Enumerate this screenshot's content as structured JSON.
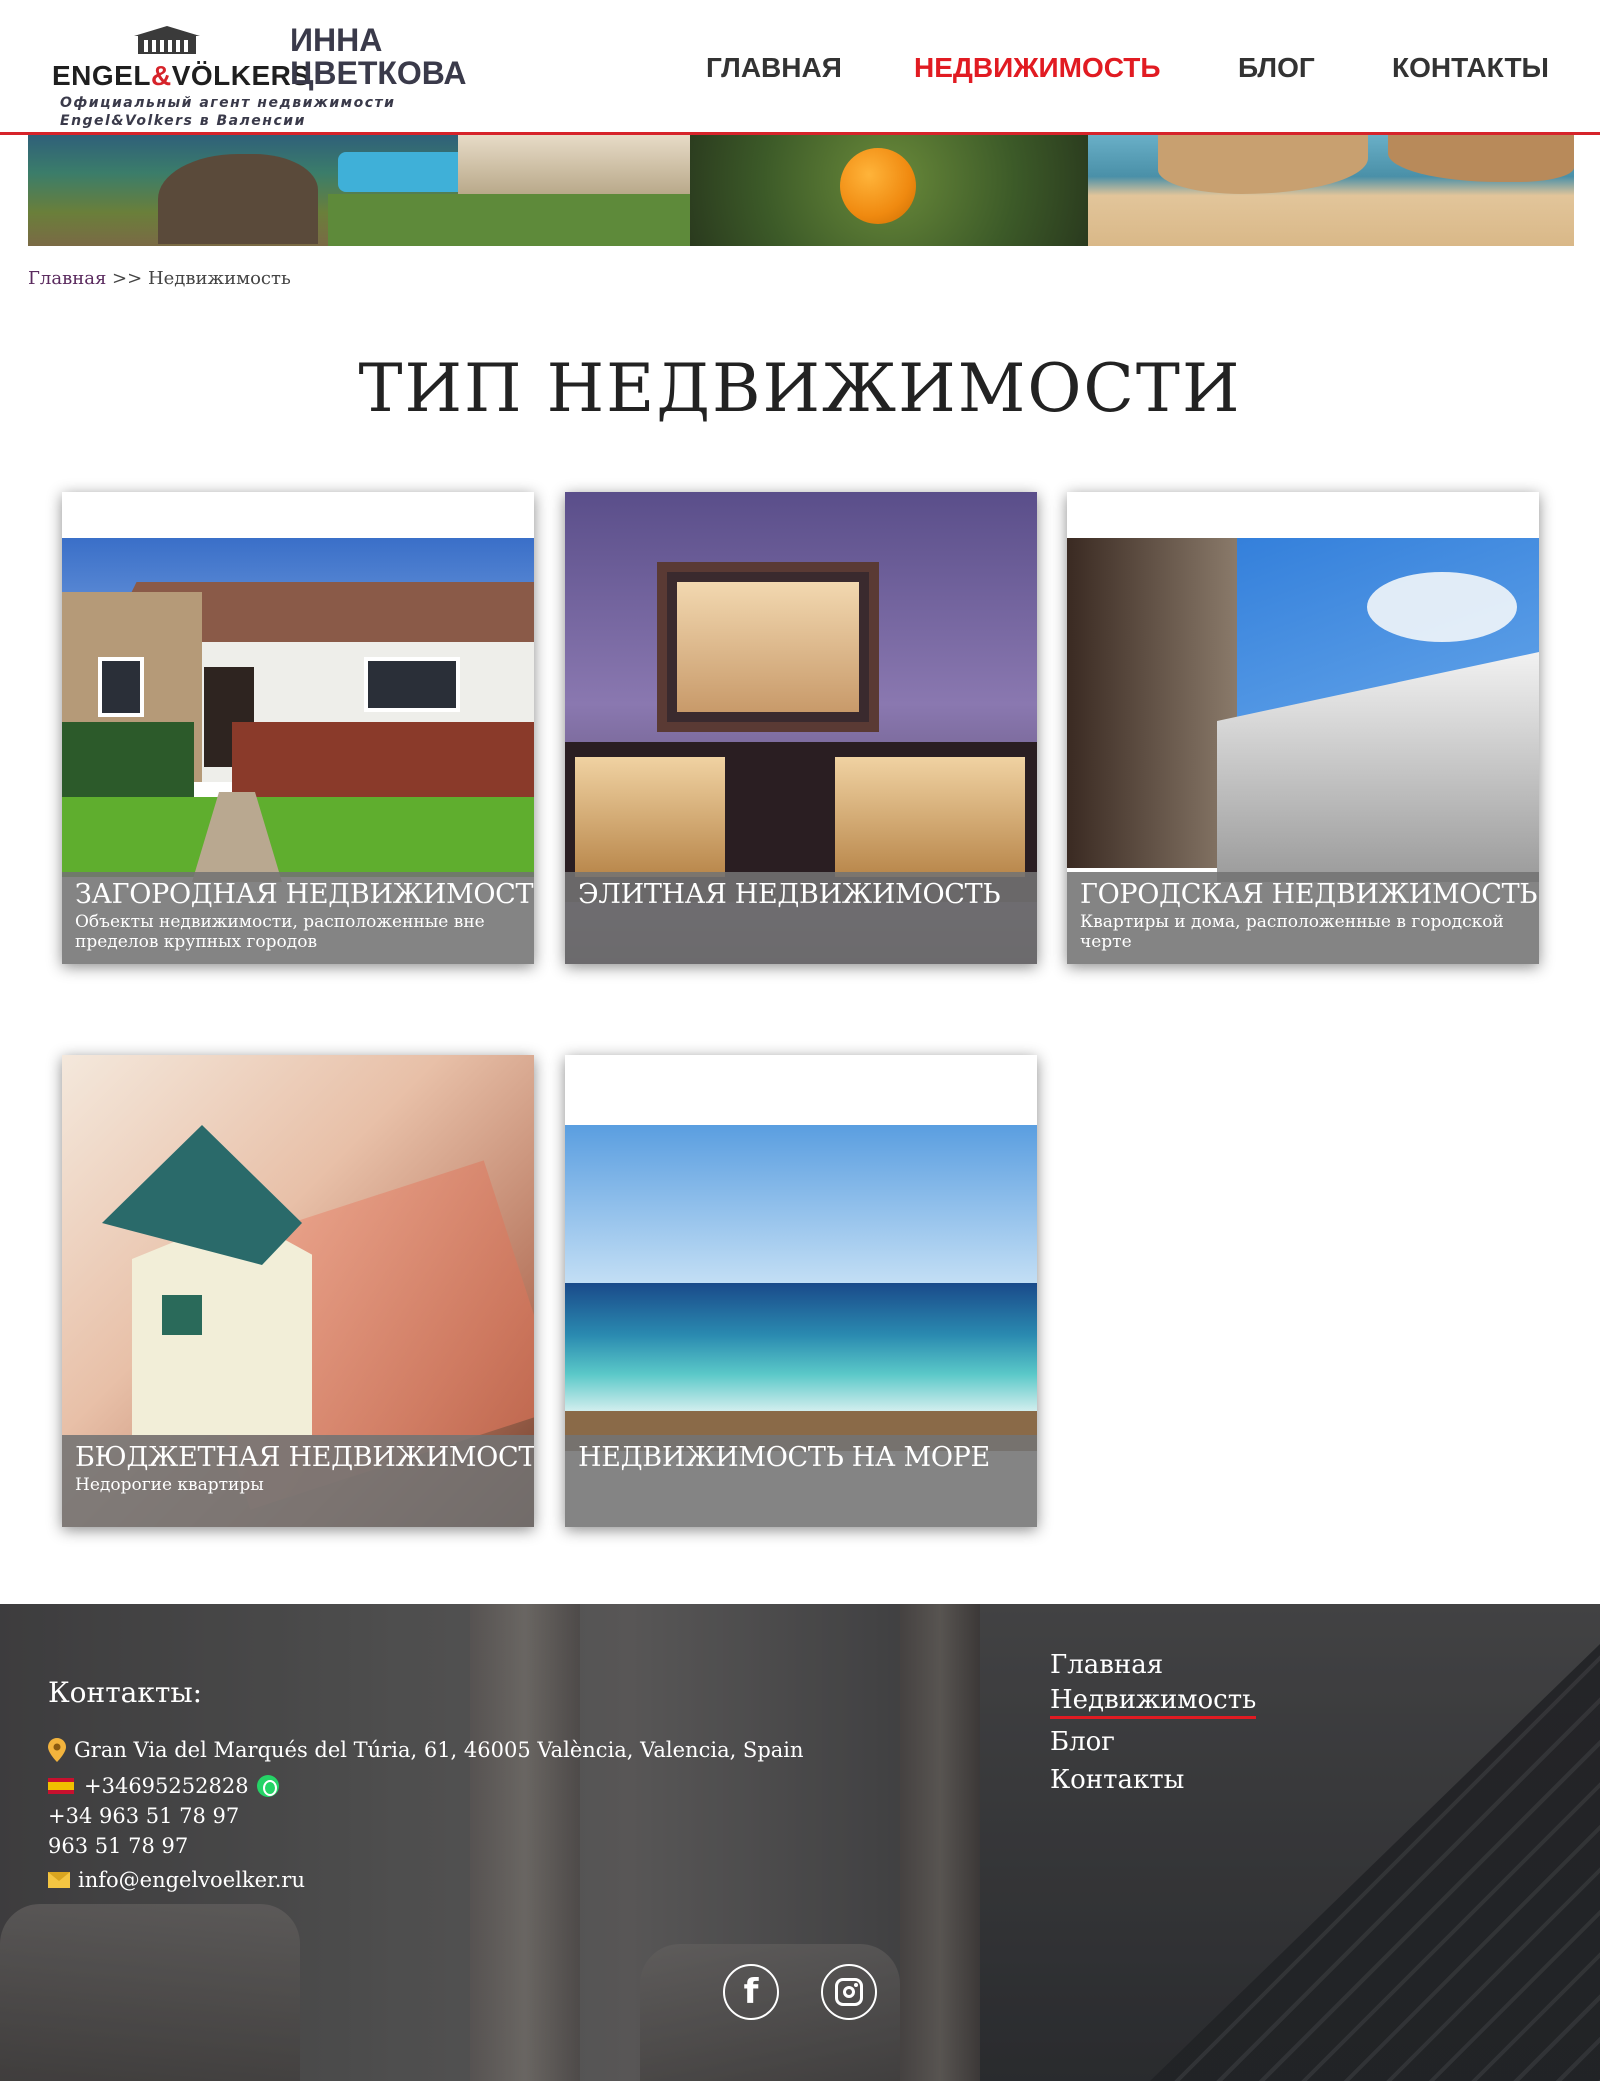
{
  "logo": {
    "brand_part1": "ENGEL",
    "brand_amp": "&",
    "brand_part2": "VÖLKERS",
    "name_line1": "ИННА",
    "name_line2": "ЦВЕТКОВА",
    "tagline_line1": "Официальный агент недвижимости",
    "tagline_line2": "Engel&Volkers  в Валенсии"
  },
  "nav": {
    "items": [
      {
        "label": "ГЛАВНАЯ"
      },
      {
        "label": "НЕДВИЖИМОСТЬ"
      },
      {
        "label": "БЛОГ"
      },
      {
        "label": "КОНТАКТЫ"
      }
    ],
    "active_color": "#e11b22"
  },
  "breadcrumb": {
    "home": "Главная",
    "separator": ">>",
    "current": "Недвижимость"
  },
  "page": {
    "title": "ТИП НЕДВИЖИМОСТИ"
  },
  "cards": [
    {
      "title": "ЗАГОРОДНАЯ НЕДВИЖИМОСТЬ",
      "description": "Объекты недвижимости, расположенные вне пределов крупных городов",
      "icon": "country-house-photo"
    },
    {
      "title": "ЭЛИТНАЯ НЕДВИЖИМОСТЬ",
      "description": "",
      "icon": "modern-villa-photo"
    },
    {
      "title": "ГОРОДСКАЯ НЕДВИЖИМОСТЬ",
      "description": "Квартиры и дома, расположенные в городской черте",
      "icon": "city-building-photo"
    },
    {
      "title": "БЮДЖЕТНАЯ НЕДВИЖИМОСТЬ",
      "description": "Недорогие квартиры",
      "icon": "house-on-money-photo"
    },
    {
      "title": "НЕДВИЖИМОСТЬ НА МОРЕ",
      "description": "",
      "icon": "sea-photo"
    }
  ],
  "footer": {
    "contacts_title": "Контакты:",
    "address": "Gran Via del Marqués del Túria, 61, 46005 València, Valencia, Spain",
    "phone_mobile": "+34695252828",
    "phone_intl": "+34 963 51 78 97",
    "phone_local": "963 51 78 97",
    "email": "info@engelvoelker.ru",
    "nav": [
      {
        "label": "Главная"
      },
      {
        "label": "Недвижимость"
      },
      {
        "label": "Блог"
      },
      {
        "label": "Контакты"
      }
    ],
    "social": {
      "facebook_glyph": "f",
      "facebook_icon": "facebook-icon",
      "instagram_icon": "instagram-icon"
    }
  },
  "colors": {
    "accent_red": "#e11b22",
    "header_rule": "#d6232a",
    "caption_bg": "#737373"
  }
}
